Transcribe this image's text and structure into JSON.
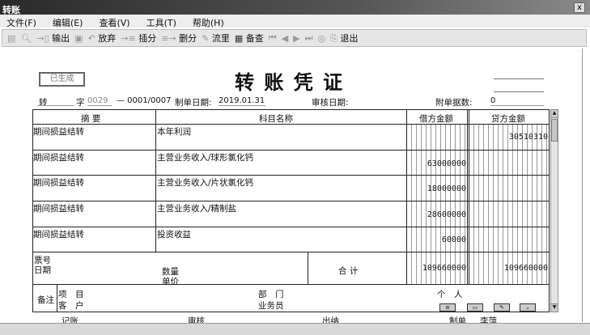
{
  "window": {
    "title": "转账",
    "close": "x"
  },
  "menu": [
    "文件(F)",
    "编辑(E)",
    "查看(V)",
    "工具(T)",
    "帮助(H)"
  ],
  "toolbar": {
    "output": "输出",
    "discard": "放弃",
    "insert": "插分",
    "delete": "删分",
    "flow": "流里",
    "check": "备查",
    "exit": "退出"
  },
  "voucher": {
    "status_stamp": "已生成",
    "title": "转 账 凭 证",
    "type": "转",
    "zi": "字",
    "number": "0029",
    "seq": "— 0001/0007",
    "date_label": "制单日期:",
    "date": "2019.01.31",
    "audit_label": "审核日期:",
    "attach_label": "附单据数:",
    "attach_count": "0",
    "headers": {
      "summary": "摘 要",
      "account": "科目名称",
      "debit": "借方金额",
      "credit": "贷方金额"
    },
    "rows": [
      {
        "summary": "期间损益结转",
        "account": "本年利润",
        "debit": "",
        "credit": "30510310"
      },
      {
        "summary": "期间损益结转",
        "account": "主营业务收入/球形氯化钙",
        "debit": "63000000",
        "credit": ""
      },
      {
        "summary": "期间损益结转",
        "account": "主营业务收入/片状氯化钙",
        "debit": "18000000",
        "credit": ""
      },
      {
        "summary": "期间损益结转",
        "account": "主营业务收入/精制盐",
        "debit": "28600000",
        "credit": ""
      },
      {
        "summary": "期间损益结转",
        "account": "投资收益",
        "debit": "60000",
        "credit": ""
      }
    ],
    "ticket_no": "票号",
    "ticket_date": "日期",
    "qty": "数量",
    "price": "单价",
    "total_label": "合 计",
    "total_debit": "109660000",
    "total_credit": "109660000",
    "remark": "备注",
    "project": "项　目",
    "customer": "客　户",
    "dept": "部　门",
    "salesman": "业务员",
    "person": "个　人"
  },
  "footer": {
    "bookkeeper": "记账",
    "auditor": "审核",
    "cashier": "出纳",
    "maker_label": "制单",
    "maker": "李萍"
  }
}
